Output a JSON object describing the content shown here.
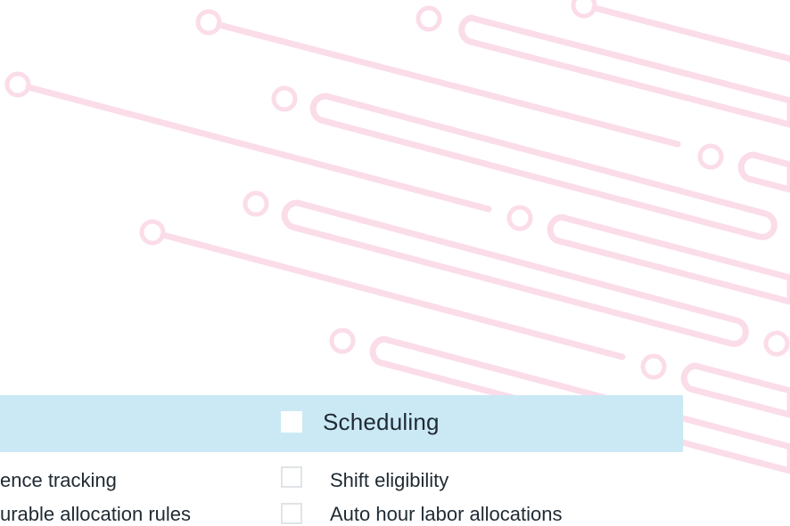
{
  "columns": [
    {
      "title": "",
      "items": [
        "ence tracking",
        "urable allocation rules"
      ]
    },
    {
      "title": "Scheduling",
      "items": [
        "Shift eligibility",
        "Auto hour labor allocations"
      ]
    }
  ],
  "colors": {
    "band": "#cbe9f5",
    "decor_lines": "#fbdce9",
    "text": "#1f2a33",
    "checkbox_border": "#e1e4e7"
  }
}
